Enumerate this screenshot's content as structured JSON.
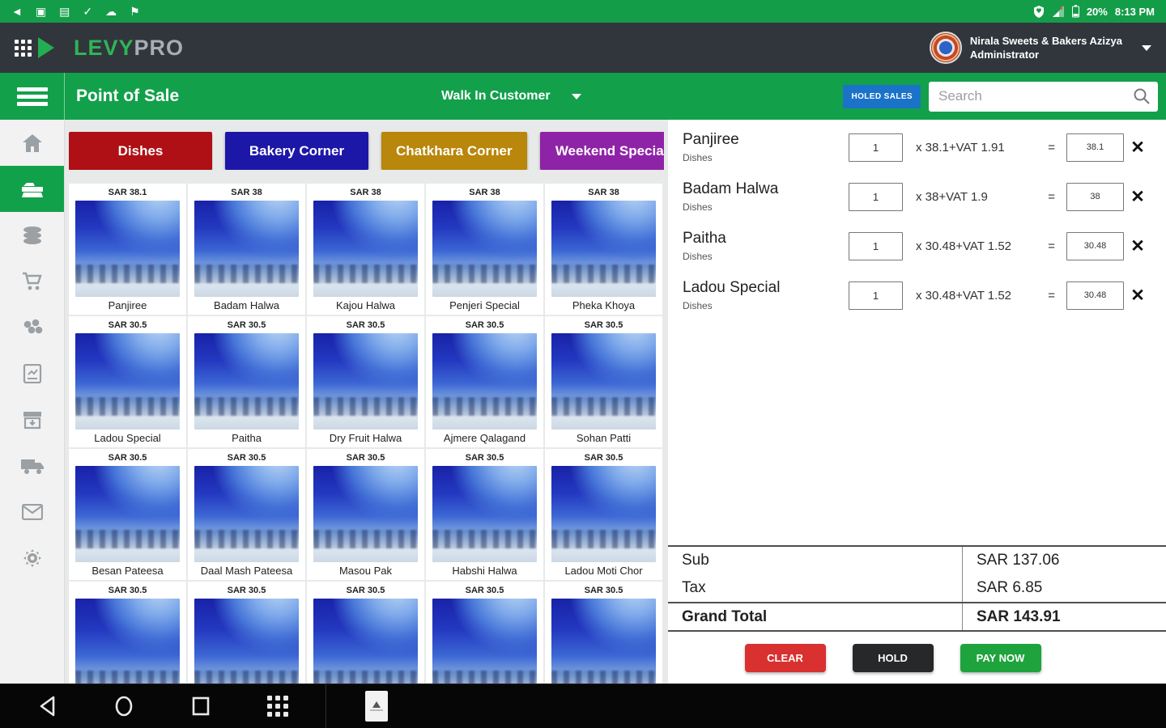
{
  "accent": {
    "green": "#13a04b",
    "header_dark": "#31363c",
    "hold_sales_blue": "#1a73c9"
  },
  "status_bar": {
    "time": "8:13 PM",
    "battery_percent": "20%",
    "left_icons": [
      "share-icon",
      "app-notification-icon",
      "sd-card-icon",
      "check-icon",
      "cloud-upload-icon",
      "bluetooth-transfer-icon"
    ],
    "right_icons": [
      "vpn-shield-icon",
      "signal-icon",
      "battery-icon"
    ]
  },
  "app_header": {
    "brand_primary": "LEVY",
    "brand_secondary": "PRO",
    "account_name": "Nirala Sweets & Bakers Azizya",
    "account_role": "Administrator"
  },
  "toolbar": {
    "title": "Point of Sale",
    "customer_selector": "Walk In Customer",
    "hold_sales_label": "HOLED SALES",
    "search_placeholder": "Search",
    "search_value": ""
  },
  "sidebar": {
    "items": [
      {
        "icon": "home-icon",
        "active": false
      },
      {
        "icon": "pos-register-icon",
        "active": true
      },
      {
        "icon": "products-stack-icon",
        "active": false
      },
      {
        "icon": "cart-icon",
        "active": false
      },
      {
        "icon": "ingredients-icon",
        "active": false
      },
      {
        "icon": "reports-book-icon",
        "active": false
      },
      {
        "icon": "inventory-box-icon",
        "active": false
      },
      {
        "icon": "delivery-truck-icon",
        "active": false
      },
      {
        "icon": "messages-icon",
        "active": false
      },
      {
        "icon": "settings-gear-icon",
        "active": false
      }
    ]
  },
  "categories": [
    {
      "label": "Dishes",
      "color": "#af1015",
      "active": true
    },
    {
      "label": "Bakery Corner",
      "color": "#1d17a8",
      "active": false
    },
    {
      "label": "Chatkhara Corner",
      "color": "#b8870b",
      "active": false
    },
    {
      "label": "Weekend Special",
      "color": "#8f23a7",
      "active": false
    }
  ],
  "products": [
    {
      "price": "SAR 38.1",
      "name": "Panjiree"
    },
    {
      "price": "SAR 38",
      "name": "Badam Halwa"
    },
    {
      "price": "SAR 38",
      "name": "Kajou Halwa"
    },
    {
      "price": "SAR 38",
      "name": "Penjeri Special"
    },
    {
      "price": "SAR 38",
      "name": "Pheka Khoya"
    },
    {
      "price": "SAR 30.5",
      "name": "Ladou Special"
    },
    {
      "price": "SAR 30.5",
      "name": "Paitha"
    },
    {
      "price": "SAR 30.5",
      "name": "Dry Fruit Halwa"
    },
    {
      "price": "SAR 30.5",
      "name": "Ajmere Qalagand"
    },
    {
      "price": "SAR 30.5",
      "name": "Sohan Patti"
    },
    {
      "price": "SAR 30.5",
      "name": "Besan Pateesa"
    },
    {
      "price": "SAR 30.5",
      "name": "Daal Mash Pateesa"
    },
    {
      "price": "SAR 30.5",
      "name": "Masou Pak"
    },
    {
      "price": "SAR 30.5",
      "name": "Habshi Halwa"
    },
    {
      "price": "SAR 30.5",
      "name": "Ladou Moti Chor"
    },
    {
      "price": "SAR 30.5",
      "name": ""
    },
    {
      "price": "SAR 30.5",
      "name": ""
    },
    {
      "price": "SAR 30.5",
      "name": ""
    },
    {
      "price": "SAR 30.5",
      "name": ""
    },
    {
      "price": "SAR 30.5",
      "name": ""
    }
  ],
  "cart": {
    "items": [
      {
        "name": "Panjiree",
        "category": "Dishes",
        "qty": "1",
        "formula": "x 38.1+VAT 1.91",
        "equals": "=",
        "total": "38.1"
      },
      {
        "name": "Badam Halwa",
        "category": "Dishes",
        "qty": "1",
        "formula": "x 38+VAT 1.9",
        "equals": "=",
        "total": "38"
      },
      {
        "name": "Paitha",
        "category": "Dishes",
        "qty": "1",
        "formula": "x 30.48+VAT 1.52",
        "equals": "=",
        "total": "30.48"
      },
      {
        "name": "Ladou Special",
        "category": "Dishes",
        "qty": "1",
        "formula": "x 30.48+VAT 1.52",
        "equals": "=",
        "total": "30.48"
      }
    ],
    "remove_glyph": "✕",
    "totals": {
      "sub_label": "Sub",
      "sub_value": "SAR 137.06",
      "tax_label": "Tax",
      "tax_value": "SAR 6.85",
      "grand_label": "Grand Total",
      "grand_value": "SAR 143.91"
    },
    "actions": {
      "clear": "CLEAR",
      "hold": "HOLD",
      "pay": "PAY NOW"
    }
  },
  "nav_bar": {
    "icons": [
      "back-icon",
      "home-circle-icon",
      "recents-square-icon",
      "apps-grid-icon",
      "app-shortcut-icon"
    ]
  }
}
